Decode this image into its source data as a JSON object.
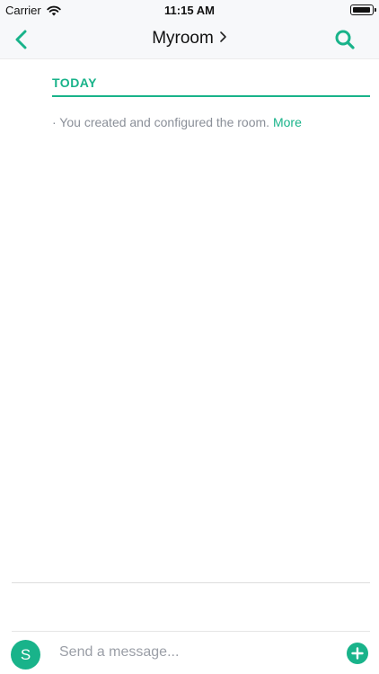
{
  "status_bar": {
    "carrier": "Carrier",
    "time": "11:15 AM"
  },
  "nav": {
    "title": "Myroom",
    "back_icon": "chevron-left-icon",
    "title_chevron_icon": "chevron-right-icon",
    "search_icon": "search-icon"
  },
  "timeline": {
    "day_header": "TODAY",
    "events": [
      {
        "text": "· You created and configured the room.",
        "link": "More"
      }
    ]
  },
  "composer": {
    "avatar_initial": "S",
    "placeholder": "Send a message...",
    "add_icon": "plus-circle-icon"
  },
  "colors": {
    "accent": "#19b38a",
    "muted_text": "#8a8f98",
    "bar_bg": "#f7f8fa"
  }
}
